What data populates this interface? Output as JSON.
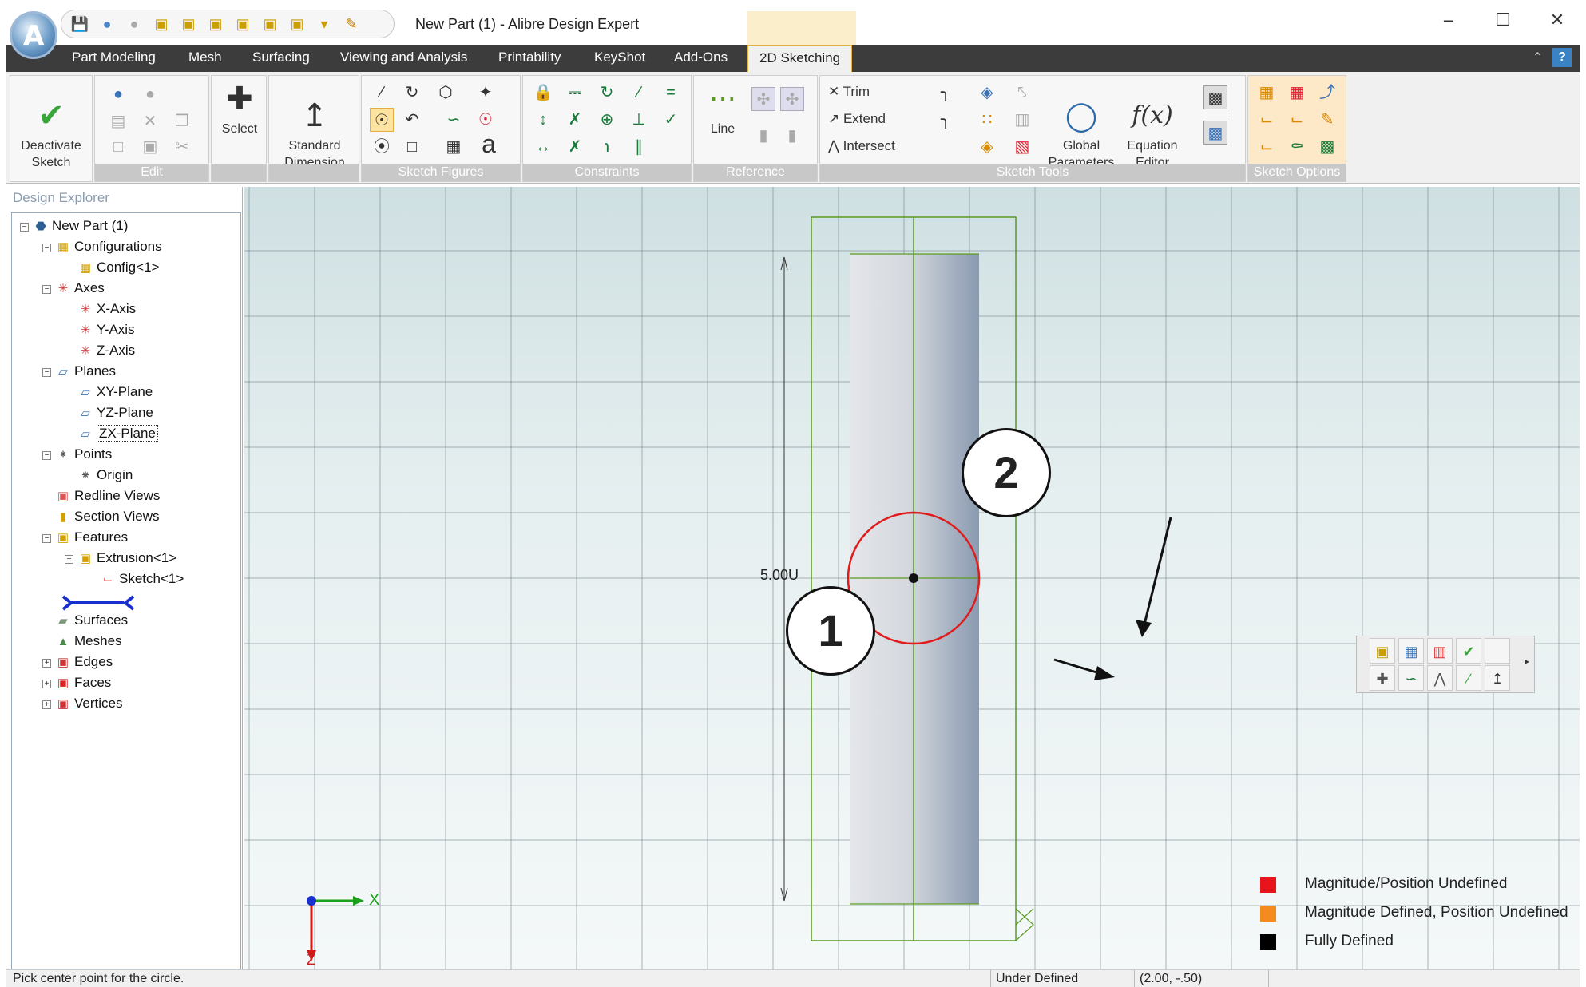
{
  "window": {
    "title": "New Part (1) - Alibre Design Expert",
    "minimize": "–",
    "maximize": "☐",
    "close": "✕"
  },
  "tabs": [
    "Part Modeling",
    "Mesh",
    "Surfacing",
    "Viewing and Analysis",
    "Printability",
    "KeyShot",
    "Add-Ons",
    "2D Sketching"
  ],
  "active_tab": "2D Sketching",
  "ribbon": {
    "groups": {
      "edit": "Edit",
      "sketch_figures": "Sketch Figures",
      "constraints": "Constraints",
      "reference": "Reference",
      "sketch_tools": "Sketch Tools",
      "sketch_options": "Sketch Options"
    },
    "deactivate": "Deactivate\nSketch",
    "select": "Select",
    "standard_dimension": "Standard\nDimension",
    "line": "Line",
    "trim": "Trim",
    "extend": "Extend",
    "intersect": "Intersect",
    "global_parameters": "Global\nParameters",
    "equation_editor": "Equation\nEditor",
    "equation_glyph": "f(x)",
    "text_glyph": "a"
  },
  "explorer": {
    "title": "Design Explorer",
    "nodes": [
      {
        "label": "New Part (1)",
        "icon": "part-icon"
      },
      {
        "label": "Configurations",
        "icon": "configurations-icon"
      },
      {
        "label": "Config<1>",
        "icon": "config-icon"
      },
      {
        "label": "Axes",
        "icon": "axes-icon"
      },
      {
        "label": "X-Axis",
        "icon": "axis-icon"
      },
      {
        "label": "Y-Axis",
        "icon": "axis-icon"
      },
      {
        "label": "Z-Axis",
        "icon": "axis-icon"
      },
      {
        "label": "Planes",
        "icon": "planes-icon"
      },
      {
        "label": "XY-Plane",
        "icon": "plane-icon"
      },
      {
        "label": "YZ-Plane",
        "icon": "plane-icon"
      },
      {
        "label": "ZX-Plane",
        "icon": "plane-icon"
      },
      {
        "label": "Points",
        "icon": "points-icon"
      },
      {
        "label": "Origin",
        "icon": "origin-icon"
      },
      {
        "label": "Redline Views",
        "icon": "redline-icon"
      },
      {
        "label": "Section Views",
        "icon": "section-icon"
      },
      {
        "label": "Features",
        "icon": "features-icon"
      },
      {
        "label": "Extrusion<1>",
        "icon": "extrusion-icon"
      },
      {
        "label": "Sketch<1>",
        "icon": "sketch-icon"
      },
      {
        "label": "Surfaces",
        "icon": "surfaces-icon"
      },
      {
        "label": "Meshes",
        "icon": "meshes-icon"
      },
      {
        "label": "Edges",
        "icon": "edges-icon"
      },
      {
        "label": "Faces",
        "icon": "faces-icon"
      },
      {
        "label": "Vertices",
        "icon": "vertices-icon"
      }
    ]
  },
  "canvas": {
    "dimension_label": "5.00U",
    "axis_label_x": "X",
    "axis_label_z": "Z"
  },
  "callouts": [
    "1",
    "2"
  ],
  "legend": [
    {
      "label": "Magnitude/Position Undefined",
      "color": "#e8141b"
    },
    {
      "label": "Magnitude Defined, Position Undefined",
      "color": "#f58a1f"
    },
    {
      "label": "Fully Defined",
      "color": "#000000"
    }
  ],
  "status": {
    "prompt": "Pick center point for the circle.",
    "state": "Under Defined",
    "coords": "(2.00, -.50)"
  },
  "colors": {
    "sketch_circle": "#e01b1b",
    "profile_lines": "#5a9a20",
    "selection_highlight": "#fce3a0",
    "active_tab_border": "#e2b040"
  }
}
